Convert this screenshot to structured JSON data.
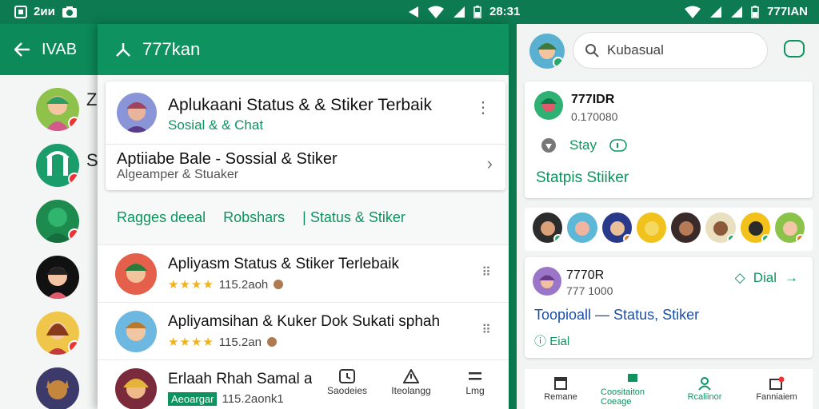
{
  "status_bar": {
    "left_text": "2ᴎᴎ",
    "middle_time": "28:31",
    "right_text": "777IAN"
  },
  "back_screen": {
    "title": "IVAB",
    "letters": [
      "Z",
      "S"
    ]
  },
  "middle_panel": {
    "header_title": "777kan",
    "card": {
      "title": "Aplukaani Status & & Stiker Terbaik",
      "subtitle": "Sosial & & Chat",
      "row_title": "Aptiiabe Bale - Sossial & Stiker",
      "row_subtitle": "Algeamper & Stuaker"
    },
    "tabs": [
      "Ragges deeal",
      "Robshars",
      "| Status & Stiker"
    ],
    "list": [
      {
        "title": "Apliyasm Status & Stiker Terlebaik",
        "rating": "★★★★",
        "meta": "115.2aoh"
      },
      {
        "title": "Apliyamsihan & Kuker Dok Sukati sphah",
        "rating": "★★★★",
        "meta": "115.2an"
      },
      {
        "title": "Erlaah Rhah Samal ad",
        "tag": "Aeoargar",
        "meta": "115.2aonk1"
      }
    ],
    "nav": [
      {
        "label": "Saodeies"
      },
      {
        "label": "Iteolangg"
      },
      {
        "label": "Lmg"
      }
    ]
  },
  "right_panel": {
    "search_placeholder": "Kubasual",
    "card1": {
      "name": "777IDR",
      "sub": "0.170080",
      "row_label": "Stay",
      "bottom": "Statpis  Stiiker"
    },
    "card2": {
      "name": "7770R",
      "sub": "777 1000",
      "dial": "Dial",
      "title": "Toopioall — Status, Stiker",
      "foot": "Eial"
    },
    "nav": [
      {
        "label": "Remane"
      },
      {
        "label": "Coositaiton Coeage"
      },
      {
        "label": "Rcaliinor"
      },
      {
        "label": "Fanniaiem"
      }
    ]
  },
  "colors": {
    "brand_green": "#0e9360",
    "status_bar": "#0d7a51",
    "link_blue": "#1a4fa8",
    "star": "#f3b21b"
  }
}
